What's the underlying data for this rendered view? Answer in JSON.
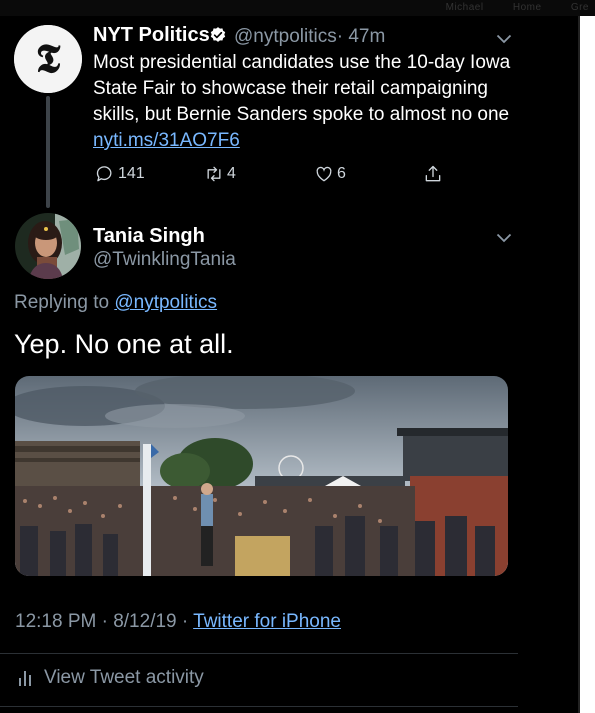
{
  "browser_tabs": [
    "Michael",
    "Home",
    "Gre"
  ],
  "original_tweet": {
    "author_name": "NYT Politics",
    "author_handle": "@nytpolitics",
    "time": "· 47m",
    "text": "Most presidential candidates use the 10-day Iowa State Fair to showcase their retail campaigning skills, but Bernie Sanders spoke to almost no one ",
    "link": "nyti.ms/31AO7F6",
    "reply_count": "141",
    "retweet_count": "4",
    "like_count": "6",
    "avatar_letter": "𝕿"
  },
  "reply_tweet": {
    "author_name": "Tania Singh",
    "author_handle": "@TwinklingTania",
    "replying_prefix": "Replying to ",
    "replying_to": "@nytpolitics",
    "text": "Yep. No one at all.",
    "timestamp": "12:18 PM · 8/12/19 · ",
    "source": "Twitter for iPhone"
  },
  "footer": {
    "activity_label": "View Tweet activity"
  },
  "colors": {
    "background": "#000000",
    "secondary_text": "#8b98a5",
    "link": "#79b8ff"
  },
  "icons": [
    "verified-badge-icon",
    "chevron-down-icon",
    "reply-icon",
    "retweet-icon",
    "like-icon",
    "share-icon",
    "bar-chart-icon"
  ]
}
